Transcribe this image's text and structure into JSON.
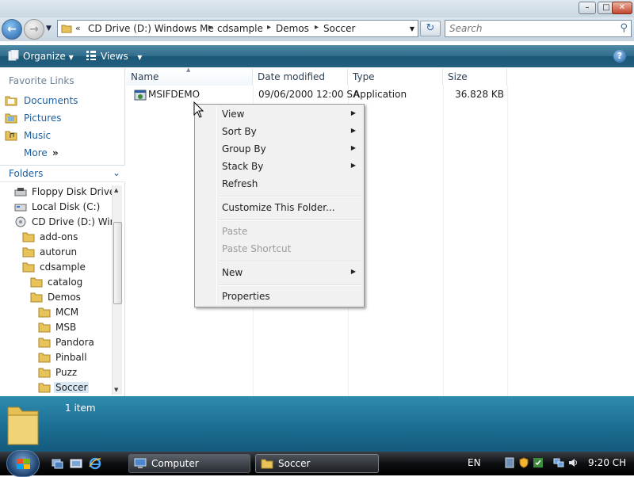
{
  "window": {
    "caption_buttons": [
      "minimize",
      "maximize",
      "close"
    ]
  },
  "address": {
    "overflow": "«",
    "crumbs": [
      "CD Drive (D:) Windows Me",
      "cdsample",
      "Demos",
      "Soccer"
    ],
    "search_placeholder": "Search"
  },
  "toolbar": {
    "organize": "Organize",
    "views": "Views",
    "help": "?"
  },
  "nav": {
    "favorites_title": "Favorite Links",
    "favorites": [
      "Documents",
      "Pictures",
      "Music"
    ],
    "more": "More",
    "more_arrows": "»",
    "folders_title": "Folders",
    "tree": [
      "Floppy Disk Drive (",
      "Local Disk (C:)",
      "CD Drive (D:) Winc",
      "add-ons",
      "autorun",
      "cdsample",
      "catalog",
      "Demos",
      "MCM",
      "MSB",
      "Pandora",
      "Pinball",
      "Puzz",
      "Soccer"
    ]
  },
  "columns": [
    "Name",
    "Date modified",
    "Type",
    "Size"
  ],
  "files": [
    {
      "name": "MSIFDEMO",
      "date": "09/06/2000 12:00 SA",
      "type": "Application",
      "size": "36.828 KB"
    }
  ],
  "context_menu": {
    "items": [
      {
        "label": "View",
        "submenu": true,
        "enabled": true
      },
      {
        "label": "Sort By",
        "submenu": true,
        "enabled": true
      },
      {
        "label": "Group By",
        "submenu": true,
        "enabled": true
      },
      {
        "label": "Stack By",
        "submenu": true,
        "enabled": true
      },
      {
        "label": "Refresh",
        "submenu": false,
        "enabled": true
      },
      {
        "label": "Customize This Folder...",
        "submenu": false,
        "enabled": true
      },
      {
        "label": "Paste",
        "submenu": false,
        "enabled": false
      },
      {
        "label": "Paste Shortcut",
        "submenu": false,
        "enabled": false
      },
      {
        "label": "New",
        "submenu": true,
        "enabled": true
      },
      {
        "label": "Properties",
        "submenu": false,
        "enabled": true
      }
    ]
  },
  "details": {
    "count": "1 item"
  },
  "taskbar": {
    "tasks": [
      "Computer",
      "Soccer"
    ],
    "language": "EN",
    "clock": "9:20 CH"
  },
  "colors": {
    "accent": "#1d5f9e",
    "toolbar": "#235f7f",
    "details_pane": "#1c6e93",
    "menu_bg": "#f1f1f1"
  }
}
